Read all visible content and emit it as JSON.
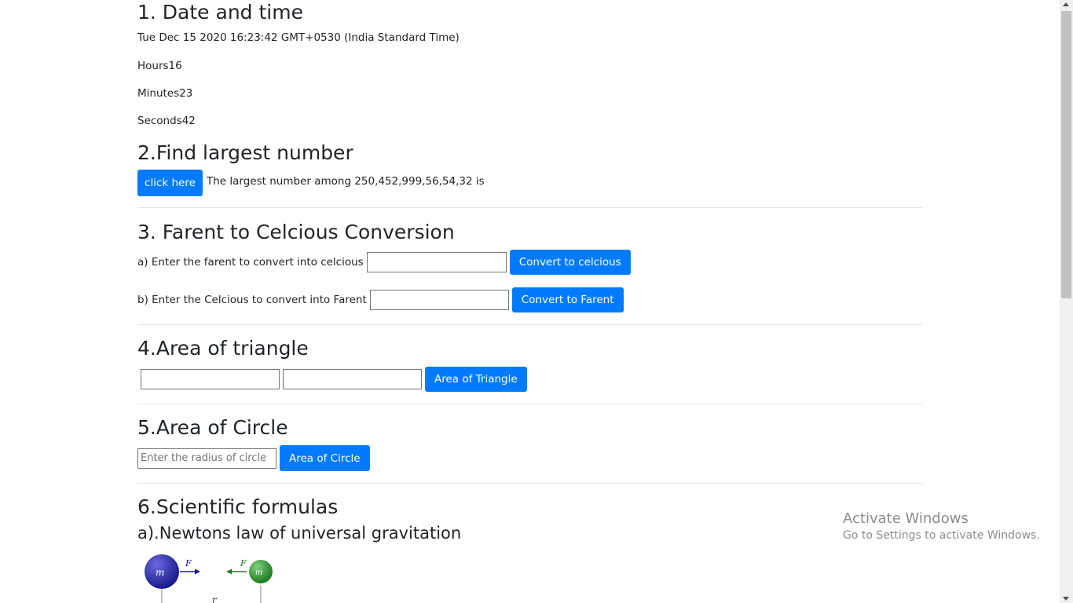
{
  "section1": {
    "heading": "1. Date and time",
    "date_string": "Tue Dec 15 2020 16:23:42 GMT+0530 (India Standard Time)",
    "hours": "Hours16",
    "minutes": "Minutes23",
    "seconds": "Seconds42"
  },
  "section2": {
    "heading": "2.Find largest number",
    "button_label": "click here",
    "result_text": "The largest number among 250,452,999,56,54,32 is"
  },
  "section3": {
    "heading": "3. Farent to Celcious Conversion",
    "row_a_label": "a) Enter the farent to convert into celcious",
    "row_a_value": "",
    "row_a_button": "Convert to celcious",
    "row_b_label": "b) Enter the Celcious to convert into Farent",
    "row_b_value": "",
    "row_b_button": "Convert to Farent"
  },
  "section4": {
    "heading": "4.Area of triangle",
    "input1_value": "",
    "input2_value": "",
    "button_label": "Area of Triangle"
  },
  "section5": {
    "heading": "5.Area of Circle",
    "radius_placeholder": "Enter the radius of circle",
    "button_label": "Area of Circle"
  },
  "section6": {
    "heading": "6.Scientific formulas",
    "subheading": "a).Newtons law of universal gravitation",
    "diagram": {
      "m1": "m",
      "m2": "m",
      "f1": "F",
      "f2": "F",
      "r": "r"
    }
  },
  "watermark": {
    "title": "Activate Windows",
    "subtitle": "Go to Settings to activate Windows."
  },
  "colors": {
    "primary": "#007bff",
    "text": "#212529",
    "watermark": "#8c8c8c"
  }
}
